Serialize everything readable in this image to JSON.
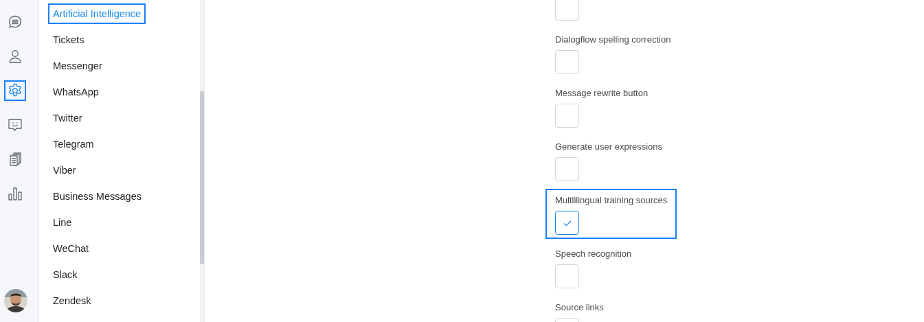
{
  "nav_rail": {
    "items": [
      {
        "kind": "chat",
        "selected": false,
        "highlighted": false
      },
      {
        "kind": "user",
        "selected": false,
        "highlighted": false
      },
      {
        "kind": "settings",
        "selected": true,
        "highlighted": true
      },
      {
        "kind": "smile",
        "selected": false,
        "highlighted": false
      },
      {
        "kind": "docs",
        "selected": false,
        "highlighted": false
      },
      {
        "kind": "chart",
        "selected": false,
        "highlighted": false
      }
    ]
  },
  "sidebar": {
    "items": [
      {
        "label": "Artificial Intelligence",
        "selected": true,
        "highlighted": true
      },
      {
        "label": "Tickets",
        "selected": false,
        "highlighted": false
      },
      {
        "label": "Messenger",
        "selected": false,
        "highlighted": false
      },
      {
        "label": "WhatsApp",
        "selected": false,
        "highlighted": false
      },
      {
        "label": "Twitter",
        "selected": false,
        "highlighted": false
      },
      {
        "label": "Telegram",
        "selected": false,
        "highlighted": false
      },
      {
        "label": "Viber",
        "selected": false,
        "highlighted": false
      },
      {
        "label": "Business Messages",
        "selected": false,
        "highlighted": false
      },
      {
        "label": "Line",
        "selected": false,
        "highlighted": false
      },
      {
        "label": "WeChat",
        "selected": false,
        "highlighted": false
      },
      {
        "label": "Slack",
        "selected": false,
        "highlighted": false
      },
      {
        "label": "Zendesk",
        "selected": false,
        "highlighted": false
      }
    ]
  },
  "settings": [
    {
      "checked": false,
      "highlighted": false
    },
    {
      "label": "Dialogflow spelling correction",
      "checked": false,
      "highlighted": false
    },
    {
      "label": "Message rewrite button",
      "checked": false,
      "highlighted": false
    },
    {
      "label": "Generate user expressions",
      "checked": false,
      "highlighted": false
    },
    {
      "label": "Multlilingual training sources",
      "checked": true,
      "highlighted": true
    },
    {
      "label": "Speech recognition",
      "checked": false,
      "highlighted": false
    },
    {
      "label": "Source links",
      "checked": false,
      "highlighted": false
    }
  ]
}
